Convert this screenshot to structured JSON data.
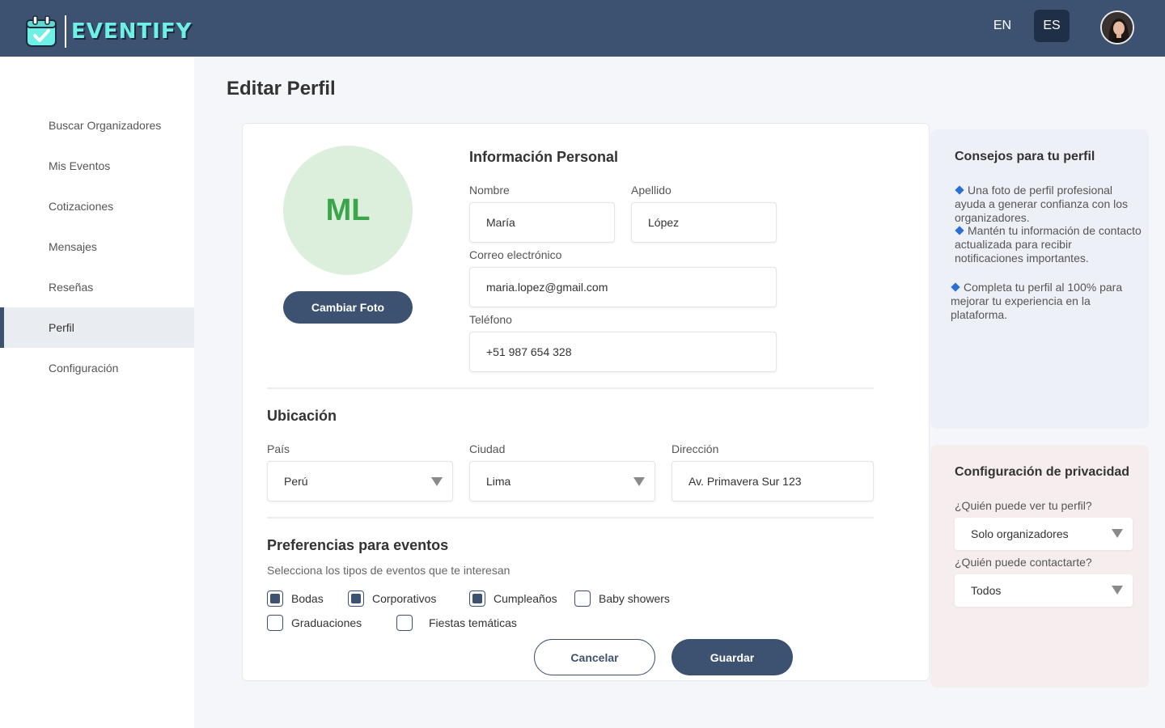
{
  "brand": {
    "name": "EVENTIFY",
    "accent": "#6ef0e6",
    "header_bg": "#3d5271"
  },
  "header": {
    "lang_en": "EN",
    "lang_es": "ES",
    "active_lang": "ES"
  },
  "sidebar": {
    "items": [
      {
        "label": "Buscar Organizadores"
      },
      {
        "label": "Mis Eventos"
      },
      {
        "label": "Cotizaciones"
      },
      {
        "label": "Mensajes"
      },
      {
        "label": "Reseñas"
      },
      {
        "label": "Perfil",
        "active": true
      },
      {
        "label": "Configuración"
      }
    ]
  },
  "page": {
    "title": "Editar Perfil"
  },
  "profile": {
    "initials": "ML",
    "change_photo_label": "Cambiar Foto",
    "personal": {
      "title": "Información Personal",
      "first_name_label": "Nombre",
      "first_name": "María",
      "last_name_label": "Apellido",
      "last_name": "López",
      "email_label": "Correo electrónico",
      "email": "maria.lopez@gmail.com",
      "phone_label": "Teléfono",
      "phone": "+51 987 654 328"
    },
    "location": {
      "title": "Ubicación",
      "country_label": "País",
      "country": "Perú",
      "city_label": "Ciudad",
      "city": "Lima",
      "address_label": "Dirección",
      "address": "Av. Primavera Sur 123"
    },
    "preferences": {
      "title": "Preferencias para eventos",
      "subtitle": "Selecciona los tipos de eventos que te interesan",
      "options": [
        {
          "label": "Bodas",
          "checked": true
        },
        {
          "label": "Corporativos",
          "checked": true
        },
        {
          "label": "Cumpleaños",
          "checked": true
        },
        {
          "label": "Baby showers",
          "checked": false
        },
        {
          "label": "Graduaciones",
          "checked": false
        },
        {
          "label": "Fiestas temáticas",
          "checked": false
        }
      ]
    },
    "actions": {
      "cancel": "Cancelar",
      "save": "Guardar"
    }
  },
  "tips": {
    "title": "Consejos para tu perfil",
    "items": [
      "Una foto de perfil profesional ayuda a generar confianza con los organizadores.",
      "Mantén tu información de contacto actualizada para recibir notificaciones importantes.",
      "Completa tu perfil al 100% para mejorar tu experiencia en la plataforma."
    ]
  },
  "privacy": {
    "title": "Configuración de privacidad",
    "who_can_see_label": "¿Quién puede ver tu perfil?",
    "who_can_see": "Solo organizadores",
    "who_can_contact_label": "¿Quién puede contactarte?",
    "who_can_contact": "Todos"
  }
}
